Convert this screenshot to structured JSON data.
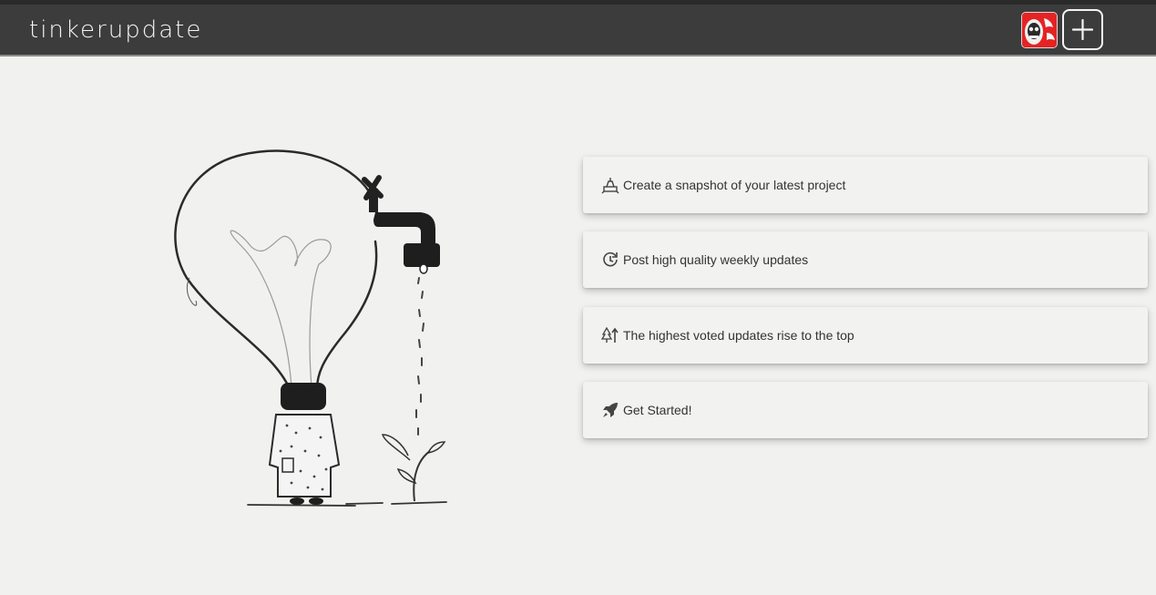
{
  "navbar": {
    "brand": "tinkerupdate",
    "avatar_icon": "user-avatar",
    "add_icon": "plus-icon"
  },
  "illustration": {
    "icon": "lightbulb-faucet-illustration"
  },
  "features": [
    {
      "icon": "project-snapshot-icon",
      "label": "Create a snapshot of your latest project"
    },
    {
      "icon": "weekly-update-icon",
      "label": "Post high quality weekly updates"
    },
    {
      "icon": "trees-rising-icon",
      "label": "The highest voted updates rise to the top"
    },
    {
      "icon": "rocket-icon",
      "label": "Get Started!"
    }
  ],
  "colors": {
    "navbar": "#3c3c3d",
    "background": "#f1f1f0",
    "card": "#f2f2f1",
    "avatar_accent": "#e42424"
  }
}
